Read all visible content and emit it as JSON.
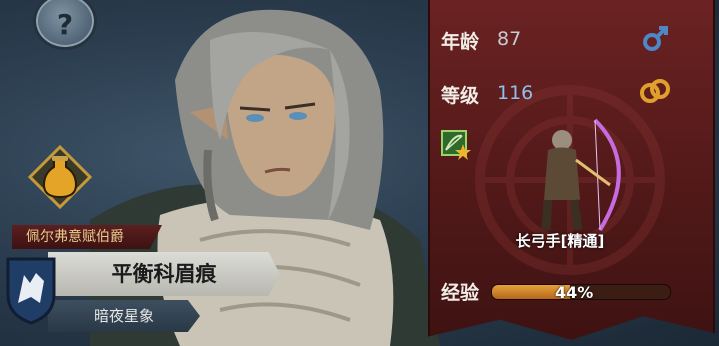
{
  "help_button": {
    "glyph": "?"
  },
  "character": {
    "title": "佩尔弗意赋伯爵",
    "name": "平衡科眉痕",
    "sign": "暗夜星象"
  },
  "stats": {
    "age_label": "年龄",
    "age_value": "87",
    "level_label": "等级",
    "level_value": "116",
    "gender_icon": "male-symbol-icon",
    "marriage_icon": "rings-icon"
  },
  "class": {
    "label": "长弓手[精通]",
    "icon": "bow-star-icon"
  },
  "experience": {
    "label": "经验",
    "percent_text": "44%",
    "fraction": 0.44
  },
  "colors": {
    "panel": "#5e1d1d",
    "level_text": "#8fc0ee",
    "exp_fill": "#d9892c"
  }
}
